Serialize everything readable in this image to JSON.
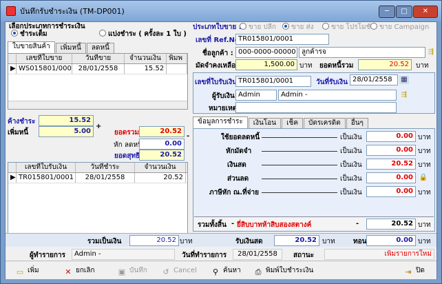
{
  "window": {
    "title": "บันทึกรับชำระเงิน (TM-DP001)",
    "minimize": "─",
    "maximize": "□",
    "close": "✕"
  },
  "payment_type": {
    "group_label": "เลือกประเภทการชำระเงิน",
    "full": "ชำระเต็ม",
    "installment": "แบ่งชำระ ( ครั้งละ 1 ใบ )"
  },
  "left_tabs": [
    "ใบขายสินค้า",
    "เพิ่มหนี้",
    "ลดหนี้"
  ],
  "sales_grid": {
    "headers": [
      "เลขที่ใบขาย",
      "วันที่ขาย",
      "จำนวนเงิน",
      "พิมพ"
    ],
    "rows": [
      {
        "marker": "▶",
        "no": "WS015801/0001",
        "date": "28/01/2558",
        "amount": "15.52",
        "print": ""
      }
    ]
  },
  "summary": {
    "outstanding_label": "ค้างชำระ",
    "outstanding": "15.52",
    "add_debt_label": "เพิ่มหนี้",
    "add_debt": "5.00",
    "plus": "+",
    "total_label": "ยอดรวม",
    "total": "20.52",
    "minus": "-",
    "reduce_label": "หัก ลดหนี้",
    "reduce": "0.00",
    "net_label": "ยอดสุทธิ",
    "net": "20.52"
  },
  "receipt_grid": {
    "headers": [
      "เลขที่ใบรับเงิน",
      "วันที่ชำระ",
      "จำนวนเงิน"
    ],
    "rows": [
      {
        "marker": "▶",
        "no": "TR015801/0001",
        "date": "28/01/2558",
        "amount": "20.52"
      }
    ]
  },
  "sale_type": {
    "label": "ประเภทใบขาย :",
    "options": [
      "ขาย ปลีก",
      "ขาย ส่ง",
      "ขาย โปรโมชั่น",
      "ขาย Campaign"
    ],
    "selected": 1
  },
  "header": {
    "ref_label": "เลขที่ Ref.No :",
    "ref": "TR015801/0001",
    "customer_label": "ชื่อลูกค้า :",
    "customer_code": "000-0000-00000",
    "customer_name": "ลูกค้ารจ",
    "deposit_label": "มัดจำคงเหลือ :",
    "deposit": "1,500.00",
    "baht": "บาท",
    "debt_total_label": "ยอดหนี้รวม",
    "debt_total": "20.52"
  },
  "receipt": {
    "no_label": "เลขที่ใบรับเงิน",
    "no": "TR015801/0001",
    "date_label": "วันที่รับเงิน",
    "date": "28/01/2558",
    "receiver_label": "ผู้รับเงิน",
    "receiver_code": "Admin",
    "receiver_name": "Admin -",
    "note_label": "หมายเหตุ",
    "note": ""
  },
  "pay_tabs": [
    "ข้อมูลการชำระ",
    "เงินโอน",
    "เช็ค",
    "บัตรเครดิต",
    "อื่นๆ"
  ],
  "pay_lines": [
    {
      "label": "ใช้ยอดลดหนี้",
      "sep": "เป็นเงิน",
      "value": "0.00",
      "unit": "บาท"
    },
    {
      "label": "หักมัดจำ",
      "sep": "เป็นเงิน",
      "value": "0.00",
      "unit": "บาท"
    },
    {
      "label": "เงินสด",
      "sep": "เป็นเงิน",
      "value": "20.52",
      "unit": "บาท"
    },
    {
      "label": "ส่วนลด",
      "sep": "เป็นเงิน",
      "value": "0.00",
      "unit": "บาท"
    },
    {
      "label": "ภาษีหัก ณ.ที่จ่าย",
      "sep": "เป็นเงิน",
      "value": "0.00",
      "unit": "บาท"
    }
  ],
  "grand": {
    "label": "รวมทั้งสิ้น",
    "dash": "-",
    "words": "ยี่สิบบาทห้าสิบสองสตางค์",
    "dash2": "-",
    "value": "20.52",
    "unit": "บาท"
  },
  "totals": {
    "sum_label": "รวมเป็นเงิน",
    "sum": "20.52",
    "sum_unit": "บาท",
    "received_label": "รับเงินสด",
    "received": "20.52",
    "received_unit": "บาท",
    "change_label": "ทอน",
    "change": "0.00",
    "change_unit": "บาท"
  },
  "footer": {
    "creator_label": "ผู้ทำรายการ",
    "creator": "Admin -",
    "created_label": "วันที่ทำรายการ",
    "created": "28/01/2558",
    "status_label": "สถานะ",
    "status": "เพิ่มรายการใหม่"
  },
  "toolbar": {
    "add": "เพิ่ม",
    "cancel_doc": "ยกเลิก",
    "save": "บันทึก",
    "cancel": "Cancel",
    "search": "ค้นหา",
    "print": "พิมพ์ใบชำระเงิน",
    "close": "ปิด"
  },
  "colors": {
    "label_blue": "#1a1aa8",
    "value_red": "#e00000",
    "input_yellow": "#ffffc8",
    "frame_blue": "#7a9ec9"
  }
}
